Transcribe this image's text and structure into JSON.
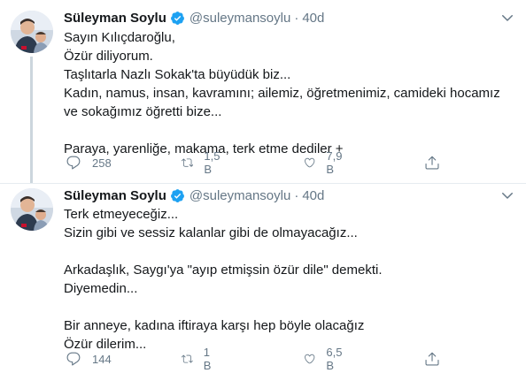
{
  "colors": {
    "text": "#14171a",
    "secondary": "#657786",
    "verified": "#1da1f2",
    "divider": "#e6ecf0",
    "thread_line": "#ccd6dd"
  },
  "tweets": [
    {
      "author": {
        "display_name": "Süleyman Soylu",
        "handle": "@suleymansoylu",
        "verified": true
      },
      "separator": "·",
      "time": "40d",
      "text_lines": [
        "Sayın Kılıçdaroğlu,",
        "Özür diliyorum.",
        "Taşlıtarla Nazlı Sokak'ta büyüdük biz...",
        "Kadın, namus, insan, kavramını; ailemiz, öğretmenimiz, camideki hocamız",
        "ve sokağımız öğretti bize...",
        "",
        "Paraya, yarenliğe, makama, terk etme dediler +"
      ],
      "actions": {
        "reply_count": "258",
        "retweet_count": "1,5 B",
        "like_count": "7,9 B"
      },
      "icons": [
        "reply-icon",
        "retweet-icon",
        "like-icon",
        "share-icon",
        "caret-down-icon",
        "verified-badge-icon"
      ]
    },
    {
      "author": {
        "display_name": "Süleyman Soylu",
        "handle": "@suleymansoylu",
        "verified": true
      },
      "separator": "·",
      "time": "40d",
      "text_lines": [
        "Terk etmeyeceğiz...",
        "Sizin gibi ve sessiz kalanlar gibi de olmayacağız...",
        "",
        "Arkadaşlık, Saygı'ya \"ayıp etmişsin özür dile\" demekti.",
        "Diyemedin...",
        "",
        "Bir anneye, kadına iftiraya karşı hep böyle olacağız",
        "Özür dilerim..."
      ],
      "actions": {
        "reply_count": "144",
        "retweet_count": "1 B",
        "like_count": "6,5 B"
      },
      "icons": [
        "reply-icon",
        "retweet-icon",
        "like-icon",
        "share-icon",
        "caret-down-icon",
        "verified-badge-icon"
      ]
    }
  ]
}
